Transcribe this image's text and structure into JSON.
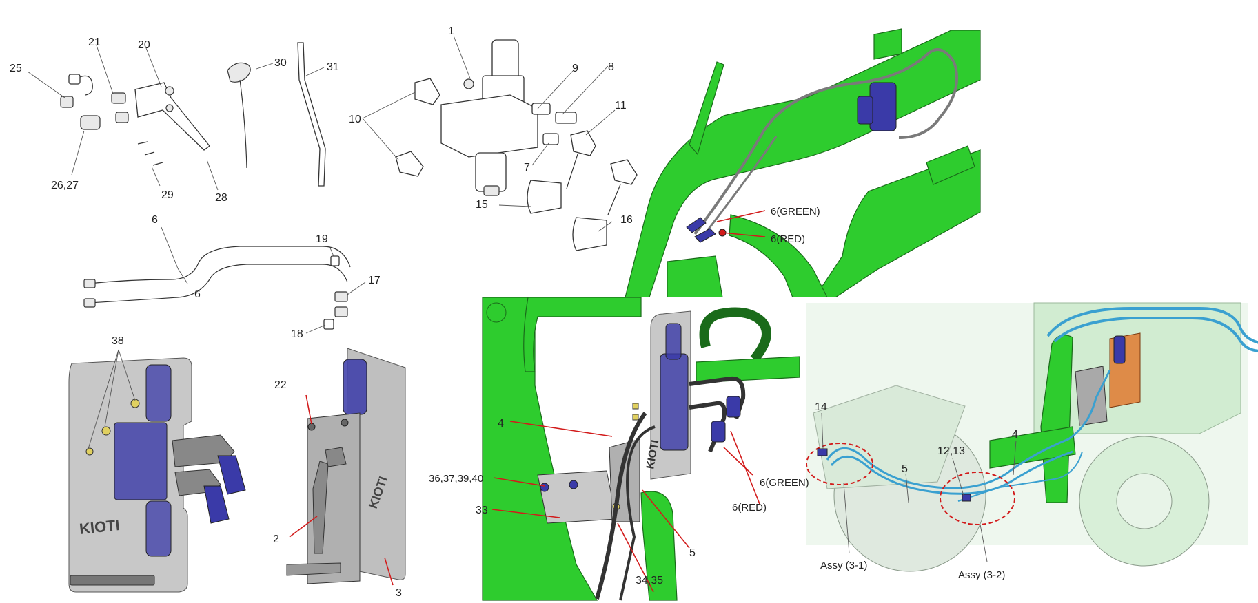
{
  "callouts": {
    "c1": "1",
    "c2": "2",
    "c3": "3",
    "c4a": "4",
    "c4b": "4",
    "c5a": "5",
    "c5b": "5",
    "c6a": "6",
    "c6b": "6",
    "c6green_a": "6(GREEN)",
    "c6red_a": "6(RED)",
    "c6green_b": "6(GREEN)",
    "c6red_b": "6(RED)",
    "c7": "7",
    "c8": "8",
    "c9": "9",
    "c10": "10",
    "c11": "11",
    "c12_13": "12,13",
    "c14": "14",
    "c15": "15",
    "c16": "16",
    "c17": "17",
    "c18": "18",
    "c19": "19",
    "c20": "20",
    "c21": "21",
    "c22": "22",
    "c25": "25",
    "c26_27": "26,27",
    "c28": "28",
    "c29": "29",
    "c30": "30",
    "c31": "31",
    "c33": "33",
    "c34_35": "34,35",
    "c36_40": "36,37,39,40",
    "c38": "38",
    "assy1": "Assy (3-1)",
    "assy2": "Assy (3-2)"
  },
  "brand_mark": "KIOTI",
  "colors": {
    "loader_green": "#2ecc2e",
    "valve_blue": "#3a3aa8",
    "leader_red": "#d21b1b",
    "hose_cyan": "#3aa0d0",
    "guard_orange": "#e07a30"
  }
}
